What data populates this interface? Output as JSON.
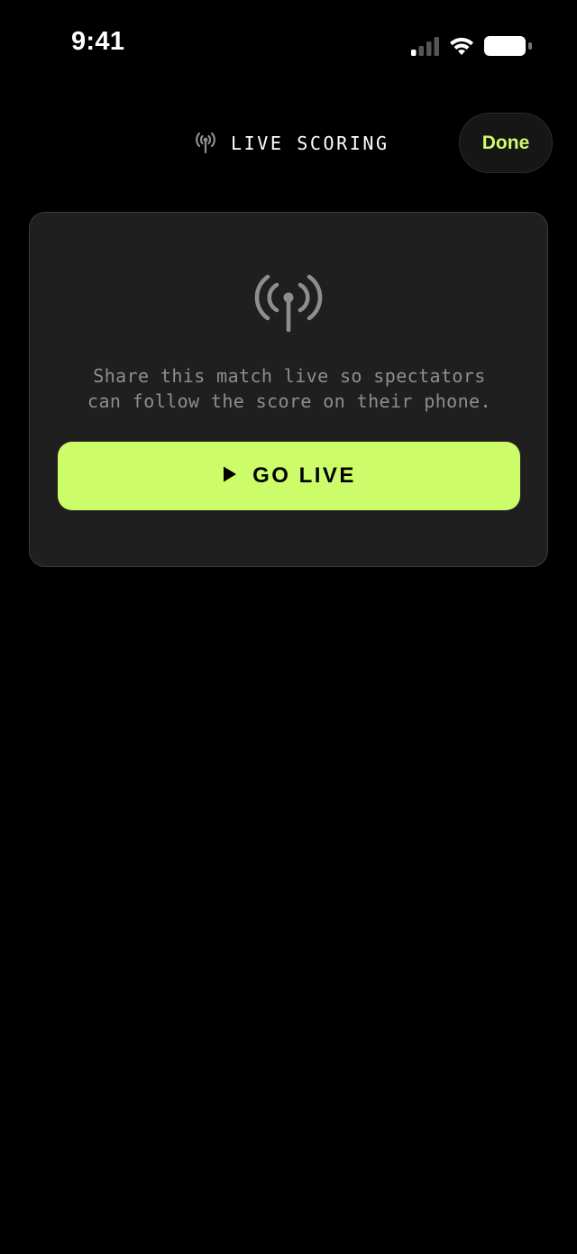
{
  "status_bar": {
    "time": "9:41",
    "icons": [
      "cellular-signal-icon",
      "wifi-icon",
      "battery-icon"
    ]
  },
  "header": {
    "title": "LIVE SCORING",
    "title_icon": "broadcast-icon",
    "done_label": "Done"
  },
  "card": {
    "icon": "broadcast-icon",
    "description_line1": "Share this match live so spectators",
    "description_line2": "can follow the score on their phone.",
    "go_live": {
      "icon": "play-icon",
      "label": "GO LIVE"
    }
  },
  "colors": {
    "background": "#000000",
    "card_background": "#1f1f20",
    "accent": "#cdfc6b",
    "muted_text": "#8e8e90"
  }
}
